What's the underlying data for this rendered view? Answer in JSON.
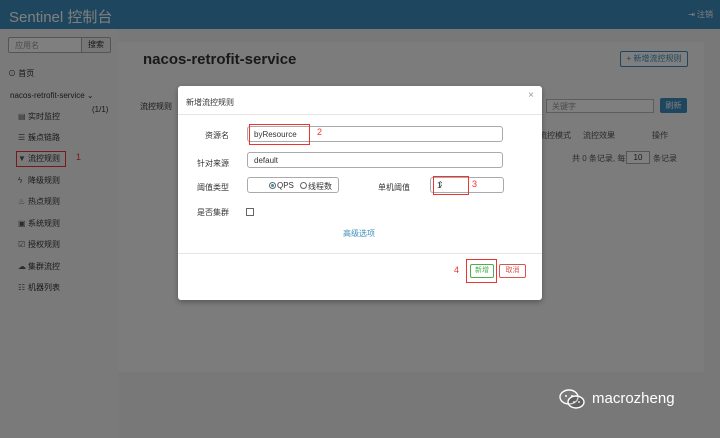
{
  "app": {
    "title": "Sentinel 控制台",
    "logout": "注销"
  },
  "sidebar": {
    "search_placeholder": "应用名",
    "search_button": "搜索",
    "home": "首页",
    "app_name": "nacos-retrofit-service",
    "app_count": "(1/1)",
    "items": [
      {
        "label": "实时监控",
        "icon": "chart-icon"
      },
      {
        "label": "簇点链路",
        "icon": "list-icon"
      },
      {
        "label": "流控规则",
        "icon": "filter-icon"
      },
      {
        "label": "降级规则",
        "icon": "bolt-icon"
      },
      {
        "label": "热点规则",
        "icon": "fire-icon"
      },
      {
        "label": "系统规则",
        "icon": "system-icon"
      },
      {
        "label": "授权规则",
        "icon": "check-icon"
      },
      {
        "label": "集群流控",
        "icon": "cloud-icon"
      },
      {
        "label": "机器列表",
        "icon": "server-icon"
      }
    ],
    "active_annotation": "1"
  },
  "main": {
    "title": "nacos-retrofit-service",
    "add_button": "新增流控规则",
    "table_title": "流控规则",
    "keyword_placeholder": "关键字",
    "query_button": "刷新",
    "columns": [
      "流控模式",
      "流控效果",
      "操作"
    ],
    "pager_text": "共 0 条记录, 每页",
    "page_size": "10",
    "pager_tail": "条记录"
  },
  "modal": {
    "title": "新增流控规则",
    "close": "×",
    "resource_label": "资源名",
    "resource_value": "byResource",
    "origin_label": "针对来源",
    "origin_value": "default",
    "threshold_type_label": "阈值类型",
    "threshold_options": [
      "QPS",
      "线程数"
    ],
    "threshold_selected": "QPS",
    "single_threshold_label": "单机阈值",
    "single_threshold_value": "1",
    "cluster_label": "是否集群",
    "advanced_link": "高级选项",
    "create_button": "新增",
    "cancel_button": "取消",
    "annotations": [
      "2",
      "3",
      "4"
    ]
  },
  "watermark": "macrozheng",
  "colors": {
    "topbar": "#3c8dbc",
    "annotation": "#ee3333",
    "primary": "#3c8dbc"
  }
}
